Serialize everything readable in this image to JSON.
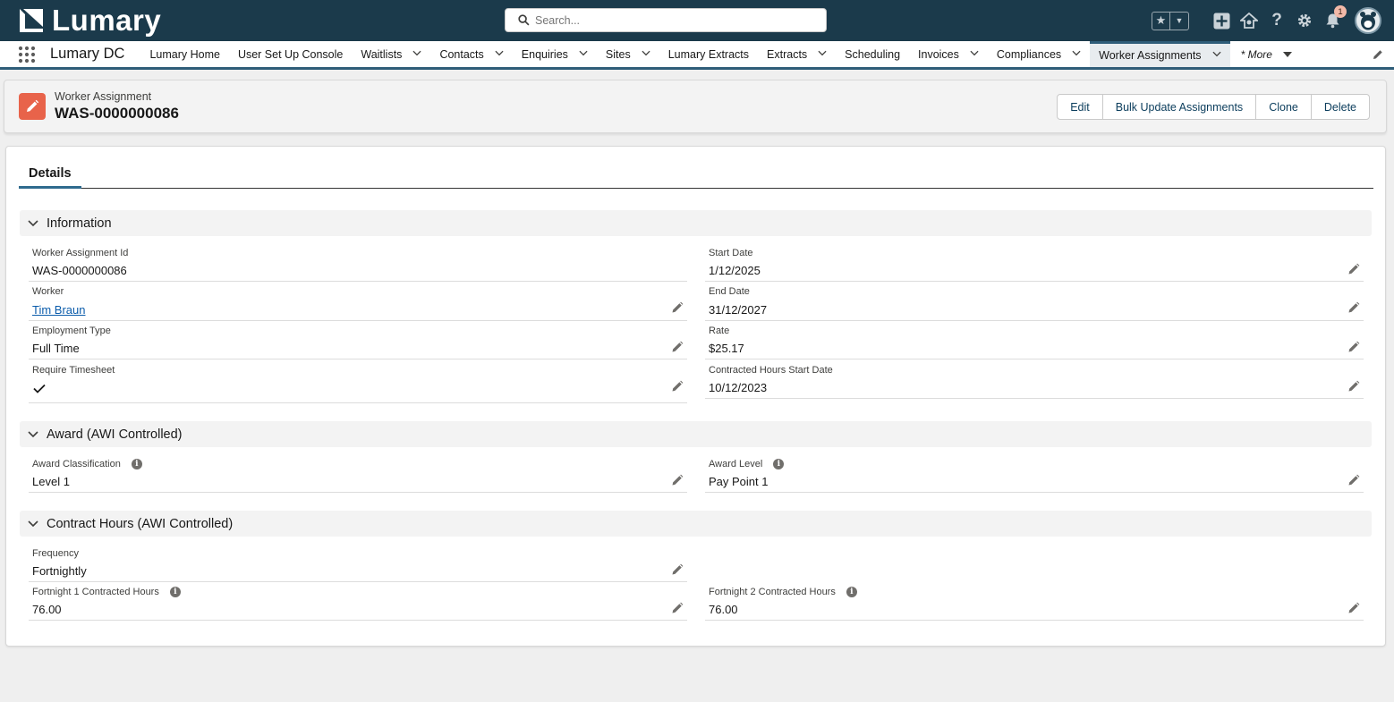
{
  "brand": {
    "name": "Lumary"
  },
  "search": {
    "placeholder": "Search..."
  },
  "topbar": {
    "notification_count": "1"
  },
  "nav": {
    "app_name": "Lumary DC",
    "items": [
      {
        "label": "Lumary Home",
        "has_menu": false
      },
      {
        "label": "User Set Up Console",
        "has_menu": false
      },
      {
        "label": "Waitlists",
        "has_menu": true
      },
      {
        "label": "Contacts",
        "has_menu": true
      },
      {
        "label": "Enquiries",
        "has_menu": true
      },
      {
        "label": "Sites",
        "has_menu": true
      },
      {
        "label": "Lumary Extracts",
        "has_menu": false
      },
      {
        "label": "Extracts",
        "has_menu": true
      },
      {
        "label": "Scheduling",
        "has_menu": false
      },
      {
        "label": "Invoices",
        "has_menu": true
      },
      {
        "label": "Compliances",
        "has_menu": true
      },
      {
        "label": "Worker Assignments",
        "has_menu": true,
        "active": true
      }
    ],
    "more_label": "* More"
  },
  "record": {
    "type_label": "Worker Assignment",
    "title": "WAS-0000000086",
    "actions": [
      "Edit",
      "Bulk Update Assignments",
      "Clone",
      "Delete"
    ]
  },
  "tabs": {
    "active": "Details"
  },
  "sections": {
    "information": {
      "title": "Information",
      "worker_assignment_id": {
        "label": "Worker Assignment Id",
        "value": "WAS-0000000086"
      },
      "start_date": {
        "label": "Start Date",
        "value": "1/12/2025"
      },
      "worker": {
        "label": "Worker",
        "value": "Tim Braun"
      },
      "end_date": {
        "label": "End Date",
        "value": "31/12/2027"
      },
      "employment_type": {
        "label": "Employment Type",
        "value": "Full Time"
      },
      "rate": {
        "label": "Rate",
        "value": "$25.17"
      },
      "require_timesheet": {
        "label": "Require Timesheet",
        "value": true
      },
      "contracted_hours_start_date": {
        "label": "Contracted Hours Start Date",
        "value": "10/12/2023"
      }
    },
    "award": {
      "title": "Award (AWI Controlled)",
      "award_classification": {
        "label": "Award Classification",
        "value": "Level 1"
      },
      "award_level": {
        "label": "Award Level",
        "value": "Pay Point 1"
      }
    },
    "contract_hours": {
      "title": "Contract Hours (AWI Controlled)",
      "frequency": {
        "label": "Frequency",
        "value": "Fortnightly"
      },
      "fortnight_1": {
        "label": "Fortnight 1 Contracted Hours",
        "value": "76.00"
      },
      "fortnight_2": {
        "label": "Fortnight 2 Contracted Hours",
        "value": "76.00"
      }
    }
  },
  "colors": {
    "topbar": "#1b3a4b",
    "accent": "#2f5d79",
    "record_icon": "#e8634a",
    "link": "#0b5cab"
  }
}
